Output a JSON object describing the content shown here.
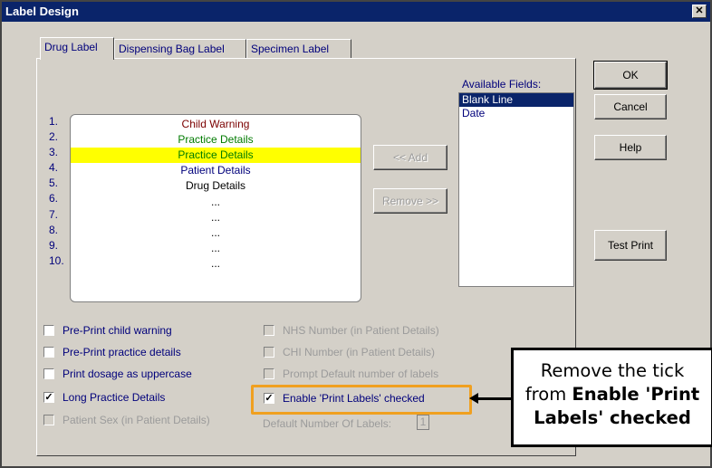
{
  "window": {
    "title": "Label Design",
    "close_glyph": "✕"
  },
  "tabs": [
    {
      "label": "Drug Label",
      "active": true
    },
    {
      "label": "Dispensing Bag Label",
      "active": false
    },
    {
      "label": "Specimen Label",
      "active": false
    }
  ],
  "buttons": {
    "ok": "OK",
    "cancel": "Cancel",
    "help": "Help",
    "test_print": "Test Print",
    "add": "<< Add",
    "remove": "Remove >>"
  },
  "label_lines": {
    "numbers": [
      "1.",
      "2.",
      "3.",
      "4.",
      "5.",
      "6.",
      "7.",
      "8.",
      "9.",
      "10."
    ],
    "items": [
      {
        "text": "Child Warning",
        "color": "#7b0000",
        "selected": false
      },
      {
        "text": "Practice Details",
        "color": "#007b00",
        "selected": false
      },
      {
        "text": "Practice Details",
        "color": "#007b00",
        "selected": true
      },
      {
        "text": "Patient Details",
        "color": "#00007b",
        "selected": false
      },
      {
        "text": "Drug Details",
        "color": "#000000",
        "selected": false
      },
      {
        "text": "...",
        "color": "#000000",
        "selected": false
      },
      {
        "text": "...",
        "color": "#000000",
        "selected": false
      },
      {
        "text": "...",
        "color": "#000000",
        "selected": false
      },
      {
        "text": "...",
        "color": "#000000",
        "selected": false
      },
      {
        "text": "...",
        "color": "#000000",
        "selected": false
      }
    ],
    "highlight_color": "#ffff00"
  },
  "available_fields": {
    "label": "Available Fields:",
    "items": [
      "Blank Line",
      "Date"
    ],
    "selected_index": 0
  },
  "options_left": [
    {
      "label": "Pre-Print child warning",
      "checked": false,
      "enabled": true
    },
    {
      "label": "Pre-Print practice details",
      "checked": false,
      "enabled": true
    },
    {
      "label": "Print dosage as uppercase",
      "checked": false,
      "enabled": true
    },
    {
      "label": "Long Practice Details",
      "checked": true,
      "enabled": true
    },
    {
      "label": "Patient Sex (in Patient Details)",
      "checked": false,
      "enabled": false
    }
  ],
  "options_right": [
    {
      "label": "NHS Number  (in Patient Details)",
      "checked": false,
      "enabled": false
    },
    {
      "label": "CHI Number  (in Patient Details)",
      "checked": false,
      "enabled": false
    },
    {
      "label": "Prompt Default number of labels",
      "checked": false,
      "enabled": false
    },
    {
      "label": "Enable 'Print Labels' checked",
      "checked": true,
      "enabled": true
    }
  ],
  "default_labels": {
    "label": "Default Number Of Labels:",
    "value": "1"
  },
  "callout": {
    "line1": "Remove the tick",
    "line2_prefix": "from ",
    "bold1": "Enable 'Print",
    "bold2": "Labels' checked",
    "border_color": "#f0a020"
  },
  "check_glyph": "✓"
}
